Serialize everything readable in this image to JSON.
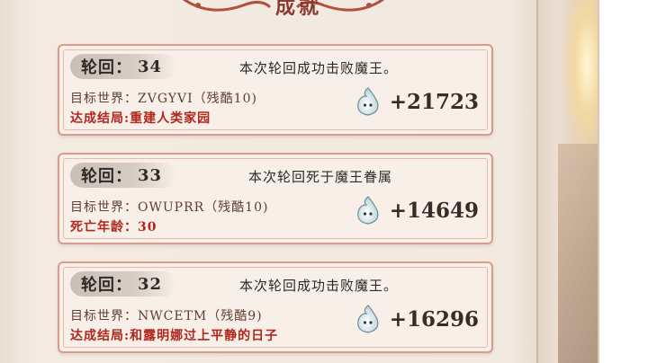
{
  "page_title": "成就",
  "currency_icon": "soul-wisp-icon",
  "colors": {
    "accent": "#b2271c",
    "card_border": "#d89b8f",
    "title": "#8a3a2c"
  },
  "records": [
    {
      "round_label": "轮回：",
      "round_num": "34",
      "event": "本次轮回成功击败魔王。",
      "world": "目标世界：ZVGYVI（残酷10)",
      "detail": "达成结局:重建人类家园",
      "reward": "+21723"
    },
    {
      "round_label": "轮回：",
      "round_num": "33",
      "event": "本次轮回死于魔王眷属",
      "world": "目标世界：OWUPRR（残酷10)",
      "detail": "死亡年龄：30",
      "reward": "+14649"
    },
    {
      "round_label": "轮回：",
      "round_num": "32",
      "event": "本次轮回成功击败魔王。",
      "world": "目标世界：NWCETM（残酷9)",
      "detail": "达成结局:和露明娜过上平静的日子",
      "reward": "+16296"
    }
  ]
}
